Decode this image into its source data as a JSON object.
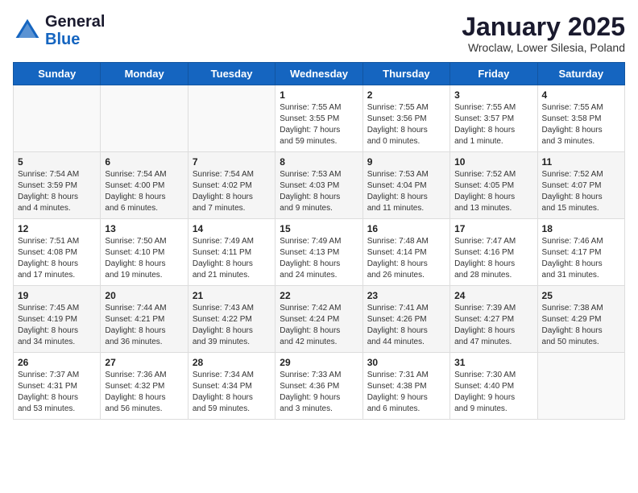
{
  "header": {
    "logo_general": "General",
    "logo_blue": "Blue",
    "month_title": "January 2025",
    "subtitle": "Wroclaw, Lower Silesia, Poland"
  },
  "weekdays": [
    "Sunday",
    "Monday",
    "Tuesday",
    "Wednesday",
    "Thursday",
    "Friday",
    "Saturday"
  ],
  "weeks": [
    [
      {
        "day": "",
        "info": ""
      },
      {
        "day": "",
        "info": ""
      },
      {
        "day": "",
        "info": ""
      },
      {
        "day": "1",
        "info": "Sunrise: 7:55 AM\nSunset: 3:55 PM\nDaylight: 7 hours\nand 59 minutes."
      },
      {
        "day": "2",
        "info": "Sunrise: 7:55 AM\nSunset: 3:56 PM\nDaylight: 8 hours\nand 0 minutes."
      },
      {
        "day": "3",
        "info": "Sunrise: 7:55 AM\nSunset: 3:57 PM\nDaylight: 8 hours\nand 1 minute."
      },
      {
        "day": "4",
        "info": "Sunrise: 7:55 AM\nSunset: 3:58 PM\nDaylight: 8 hours\nand 3 minutes."
      }
    ],
    [
      {
        "day": "5",
        "info": "Sunrise: 7:54 AM\nSunset: 3:59 PM\nDaylight: 8 hours\nand 4 minutes."
      },
      {
        "day": "6",
        "info": "Sunrise: 7:54 AM\nSunset: 4:00 PM\nDaylight: 8 hours\nand 6 minutes."
      },
      {
        "day": "7",
        "info": "Sunrise: 7:54 AM\nSunset: 4:02 PM\nDaylight: 8 hours\nand 7 minutes."
      },
      {
        "day": "8",
        "info": "Sunrise: 7:53 AM\nSunset: 4:03 PM\nDaylight: 8 hours\nand 9 minutes."
      },
      {
        "day": "9",
        "info": "Sunrise: 7:53 AM\nSunset: 4:04 PM\nDaylight: 8 hours\nand 11 minutes."
      },
      {
        "day": "10",
        "info": "Sunrise: 7:52 AM\nSunset: 4:05 PM\nDaylight: 8 hours\nand 13 minutes."
      },
      {
        "day": "11",
        "info": "Sunrise: 7:52 AM\nSunset: 4:07 PM\nDaylight: 8 hours\nand 15 minutes."
      }
    ],
    [
      {
        "day": "12",
        "info": "Sunrise: 7:51 AM\nSunset: 4:08 PM\nDaylight: 8 hours\nand 17 minutes."
      },
      {
        "day": "13",
        "info": "Sunrise: 7:50 AM\nSunset: 4:10 PM\nDaylight: 8 hours\nand 19 minutes."
      },
      {
        "day": "14",
        "info": "Sunrise: 7:49 AM\nSunset: 4:11 PM\nDaylight: 8 hours\nand 21 minutes."
      },
      {
        "day": "15",
        "info": "Sunrise: 7:49 AM\nSunset: 4:13 PM\nDaylight: 8 hours\nand 24 minutes."
      },
      {
        "day": "16",
        "info": "Sunrise: 7:48 AM\nSunset: 4:14 PM\nDaylight: 8 hours\nand 26 minutes."
      },
      {
        "day": "17",
        "info": "Sunrise: 7:47 AM\nSunset: 4:16 PM\nDaylight: 8 hours\nand 28 minutes."
      },
      {
        "day": "18",
        "info": "Sunrise: 7:46 AM\nSunset: 4:17 PM\nDaylight: 8 hours\nand 31 minutes."
      }
    ],
    [
      {
        "day": "19",
        "info": "Sunrise: 7:45 AM\nSunset: 4:19 PM\nDaylight: 8 hours\nand 34 minutes."
      },
      {
        "day": "20",
        "info": "Sunrise: 7:44 AM\nSunset: 4:21 PM\nDaylight: 8 hours\nand 36 minutes."
      },
      {
        "day": "21",
        "info": "Sunrise: 7:43 AM\nSunset: 4:22 PM\nDaylight: 8 hours\nand 39 minutes."
      },
      {
        "day": "22",
        "info": "Sunrise: 7:42 AM\nSunset: 4:24 PM\nDaylight: 8 hours\nand 42 minutes."
      },
      {
        "day": "23",
        "info": "Sunrise: 7:41 AM\nSunset: 4:26 PM\nDaylight: 8 hours\nand 44 minutes."
      },
      {
        "day": "24",
        "info": "Sunrise: 7:39 AM\nSunset: 4:27 PM\nDaylight: 8 hours\nand 47 minutes."
      },
      {
        "day": "25",
        "info": "Sunrise: 7:38 AM\nSunset: 4:29 PM\nDaylight: 8 hours\nand 50 minutes."
      }
    ],
    [
      {
        "day": "26",
        "info": "Sunrise: 7:37 AM\nSunset: 4:31 PM\nDaylight: 8 hours\nand 53 minutes."
      },
      {
        "day": "27",
        "info": "Sunrise: 7:36 AM\nSunset: 4:32 PM\nDaylight: 8 hours\nand 56 minutes."
      },
      {
        "day": "28",
        "info": "Sunrise: 7:34 AM\nSunset: 4:34 PM\nDaylight: 8 hours\nand 59 minutes."
      },
      {
        "day": "29",
        "info": "Sunrise: 7:33 AM\nSunset: 4:36 PM\nDaylight: 9 hours\nand 3 minutes."
      },
      {
        "day": "30",
        "info": "Sunrise: 7:31 AM\nSunset: 4:38 PM\nDaylight: 9 hours\nand 6 minutes."
      },
      {
        "day": "31",
        "info": "Sunrise: 7:30 AM\nSunset: 4:40 PM\nDaylight: 9 hours\nand 9 minutes."
      },
      {
        "day": "",
        "info": ""
      }
    ]
  ]
}
